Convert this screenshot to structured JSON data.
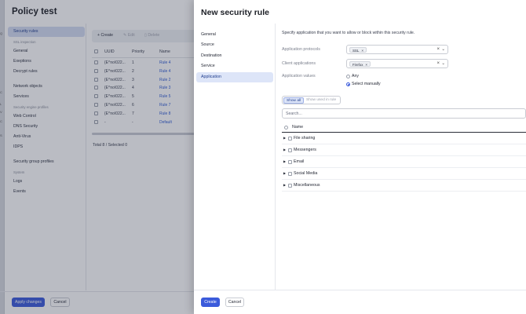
{
  "background": {
    "strip_glyphs": [
      "Q",
      "C",
      "L",
      "V",
      "C",
      "S"
    ],
    "title": "Policy test",
    "sidebar": [
      {
        "type": "item",
        "label": "Security rules",
        "active": true
      },
      {
        "type": "section",
        "label": "SSL inspection"
      },
      {
        "type": "item",
        "label": "General"
      },
      {
        "type": "item",
        "label": "Exeptions"
      },
      {
        "type": "item",
        "label": "Decrypt rules"
      },
      {
        "type": "gap"
      },
      {
        "type": "item",
        "label": "Network objects"
      },
      {
        "type": "item",
        "label": "Services"
      },
      {
        "type": "section",
        "label": "Security engine profiles"
      },
      {
        "type": "item",
        "label": "Web Control"
      },
      {
        "type": "item",
        "label": "DNS Security"
      },
      {
        "type": "item",
        "label": "Anti-Virus"
      },
      {
        "type": "item",
        "label": "IDPS"
      },
      {
        "type": "gap"
      },
      {
        "type": "item",
        "label": "Security group profiles"
      },
      {
        "type": "section",
        "label": "System"
      },
      {
        "type": "item",
        "label": "Logs"
      },
      {
        "type": "item",
        "label": "Events"
      }
    ],
    "toolbar": {
      "create": "+ Create",
      "edit": "Edit",
      "delete": "Delete"
    },
    "table": {
      "headers": [
        "UUID",
        "Priority",
        "Name"
      ],
      "rows": [
        {
          "uuid": "{E^no\\022...",
          "priority": "1",
          "name": "Rule 4"
        },
        {
          "uuid": "{E^no\\022...",
          "priority": "2",
          "name": "Rule 4"
        },
        {
          "uuid": "{E^no\\022...",
          "priority": "3",
          "name": "Rule 2"
        },
        {
          "uuid": "{E^no\\022...",
          "priority": "4",
          "name": "Rule 3"
        },
        {
          "uuid": "{E^no\\022...",
          "priority": "5",
          "name": "Rule 5"
        },
        {
          "uuid": "{E^no\\022...",
          "priority": "6",
          "name": "Rule 7"
        },
        {
          "uuid": "{E^no\\022...",
          "priority": "7",
          "name": "Rule 8"
        },
        {
          "uuid": "-",
          "priority": "-",
          "name": "Default"
        }
      ]
    },
    "total": "Total 8 / Selected 0",
    "apply_label": "Apply changes",
    "cancel_label": "Cancel"
  },
  "drawer": {
    "title": "New security rule",
    "nav": [
      {
        "label": "General",
        "active": false
      },
      {
        "label": "Source",
        "active": false
      },
      {
        "label": "Destination",
        "active": false
      },
      {
        "label": "Service",
        "active": false
      },
      {
        "label": "Application",
        "active": true
      }
    ],
    "intro": "Specify application that you want to allow or block within this security rule.",
    "fields": {
      "protocols": {
        "label": "Application protocols",
        "tag": "SSL"
      },
      "client_apps": {
        "label": "Client applications",
        "tag": "Firefox"
      },
      "app_values": {
        "label": "Application values",
        "options": [
          "Any",
          "Select manually"
        ],
        "selected": "Select manually"
      }
    },
    "filter": {
      "show_all": "Show all",
      "show_used": "Show used in rule"
    },
    "search": {
      "placeholder": "Search..."
    },
    "list": {
      "header": "Name",
      "items": [
        "File sharing",
        "Messengers",
        "Email",
        "Social Media",
        "Miscellaneous"
      ]
    },
    "create_label": "Create",
    "cancel_label": "Cancel"
  },
  "colors": {
    "accent": "#3b5bdb",
    "link": "#2f5bd3",
    "active_bg": "#dde5f8"
  },
  "icons": {
    "clear": "close-icon",
    "dropdown": "chevron-down-icon",
    "expand": "caret-right-icon"
  }
}
